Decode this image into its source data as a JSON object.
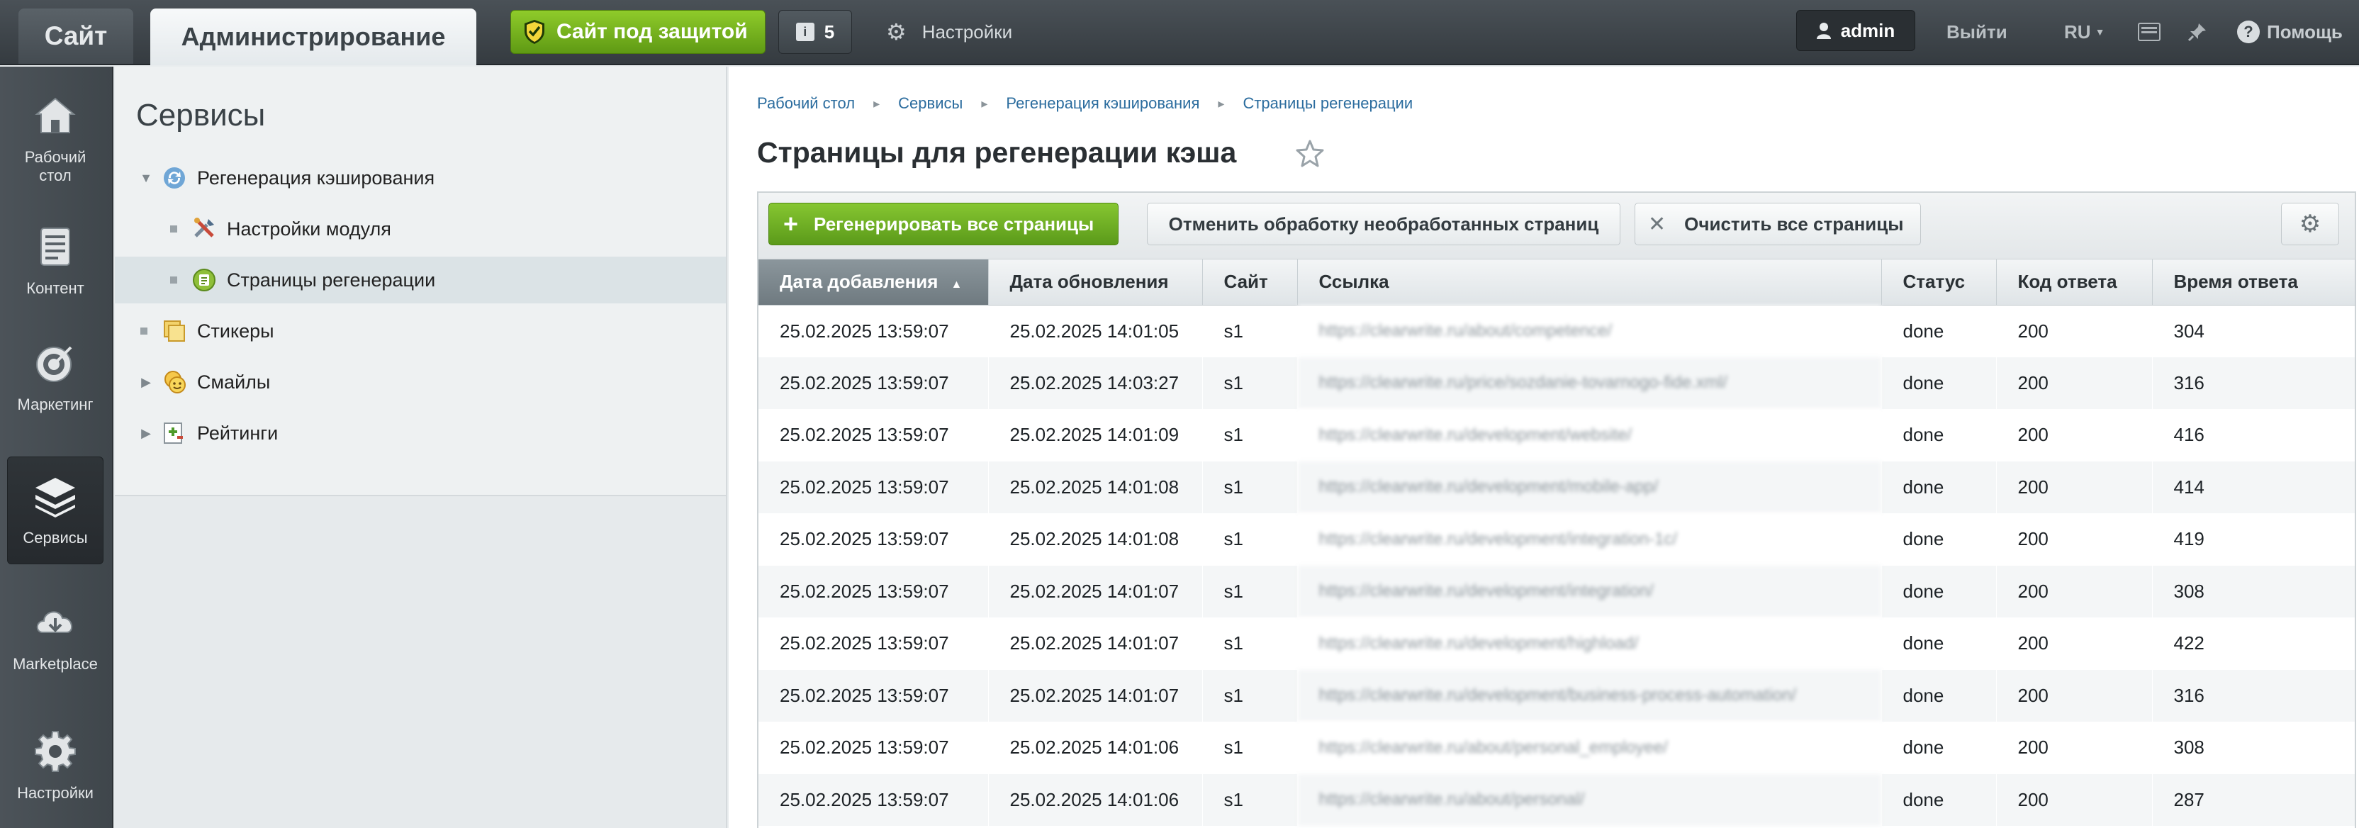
{
  "topbar": {
    "site_tab": "Сайт",
    "admin_tab": "Администрирование",
    "protect_label": "Сайт под защитой",
    "notify_count": "5",
    "notify_icon_char": "i",
    "settings_label": "Настройки",
    "user_label": "admin",
    "logout_label": "Выйти",
    "lang_label": "RU",
    "help_label": "Помощь",
    "help_icon_char": "?",
    "brand_green": "#6aaa1c",
    "bar_color": "#3f464b"
  },
  "leftnav": {
    "items": [
      {
        "label": "Рабочий стол",
        "icon": "home-icon"
      },
      {
        "label": "Контент",
        "icon": "document-icon"
      },
      {
        "label": "Маркетинг",
        "icon": "target-icon"
      },
      {
        "label": "Сервисы",
        "icon": "layers-icon",
        "active": true
      },
      {
        "label": "Marketplace",
        "icon": "cloud-download-icon"
      },
      {
        "label": "Настройки",
        "icon": "gear-icon"
      }
    ]
  },
  "tree": {
    "title": "Сервисы",
    "items": [
      {
        "label": "Регенерация кэширования",
        "icon": "refresh-icon",
        "expanded": true
      },
      {
        "label": "Настройки модуля",
        "icon": "tools-icon"
      },
      {
        "label": "Страницы регенерации",
        "icon": "regen-pages-icon",
        "selected": true
      },
      {
        "label": "Стикеры",
        "icon": "sticker-icon"
      },
      {
        "label": "Смайлы",
        "icon": "smiley-icon"
      },
      {
        "label": "Рейтинги",
        "icon": "rating-icon"
      }
    ]
  },
  "breadcrumb": [
    "Рабочий стол",
    "Сервисы",
    "Регенерация кэширования",
    "Страницы регенерации"
  ],
  "page_title": "Страницы для регенерации кэша",
  "toolbar": {
    "regenerate_all": "Регенерировать все страницы",
    "cancel_unprocessed": "Отменить обработку необработанных страниц",
    "clear_all": "Очистить все страницы"
  },
  "table": {
    "columns": [
      "Дата добавления",
      "Дата обновления",
      "Сайт",
      "Ссылка",
      "Статус",
      "Код ответа",
      "Время ответа"
    ],
    "sorted_column": 0,
    "rows": [
      [
        "25.02.2025 13:59:07",
        "25.02.2025 14:01:05",
        "s1",
        "https://clearwrite.ru/about/competence/",
        "done",
        "200",
        "304"
      ],
      [
        "25.02.2025 13:59:07",
        "25.02.2025 14:03:27",
        "s1",
        "https://clearwrite.ru/price/sozdanie-tovarnogo-fide.xml/",
        "done",
        "200",
        "316"
      ],
      [
        "25.02.2025 13:59:07",
        "25.02.2025 14:01:09",
        "s1",
        "https://clearwrite.ru/development/website/",
        "done",
        "200",
        "416"
      ],
      [
        "25.02.2025 13:59:07",
        "25.02.2025 14:01:08",
        "s1",
        "https://clearwrite.ru/development/mobile-app/",
        "done",
        "200",
        "414"
      ],
      [
        "25.02.2025 13:59:07",
        "25.02.2025 14:01:08",
        "s1",
        "https://clearwrite.ru/development/integration-1c/",
        "done",
        "200",
        "419"
      ],
      [
        "25.02.2025 13:59:07",
        "25.02.2025 14:01:07",
        "s1",
        "https://clearwrite.ru/development/integration/",
        "done",
        "200",
        "308"
      ],
      [
        "25.02.2025 13:59:07",
        "25.02.2025 14:01:07",
        "s1",
        "https://clearwrite.ru/development/highload/",
        "done",
        "200",
        "422"
      ],
      [
        "25.02.2025 13:59:07",
        "25.02.2025 14:01:07",
        "s1",
        "https://clearwrite.ru/development/business-process-automation/",
        "done",
        "200",
        "316"
      ],
      [
        "25.02.2025 13:59:07",
        "25.02.2025 14:01:06",
        "s1",
        "https://clearwrite.ru/about/personal_employee/",
        "done",
        "200",
        "308"
      ],
      [
        "25.02.2025 13:59:07",
        "25.02.2025 14:01:06",
        "s1",
        "https://clearwrite.ru/about/personal/",
        "done",
        "200",
        "287"
      ]
    ]
  }
}
